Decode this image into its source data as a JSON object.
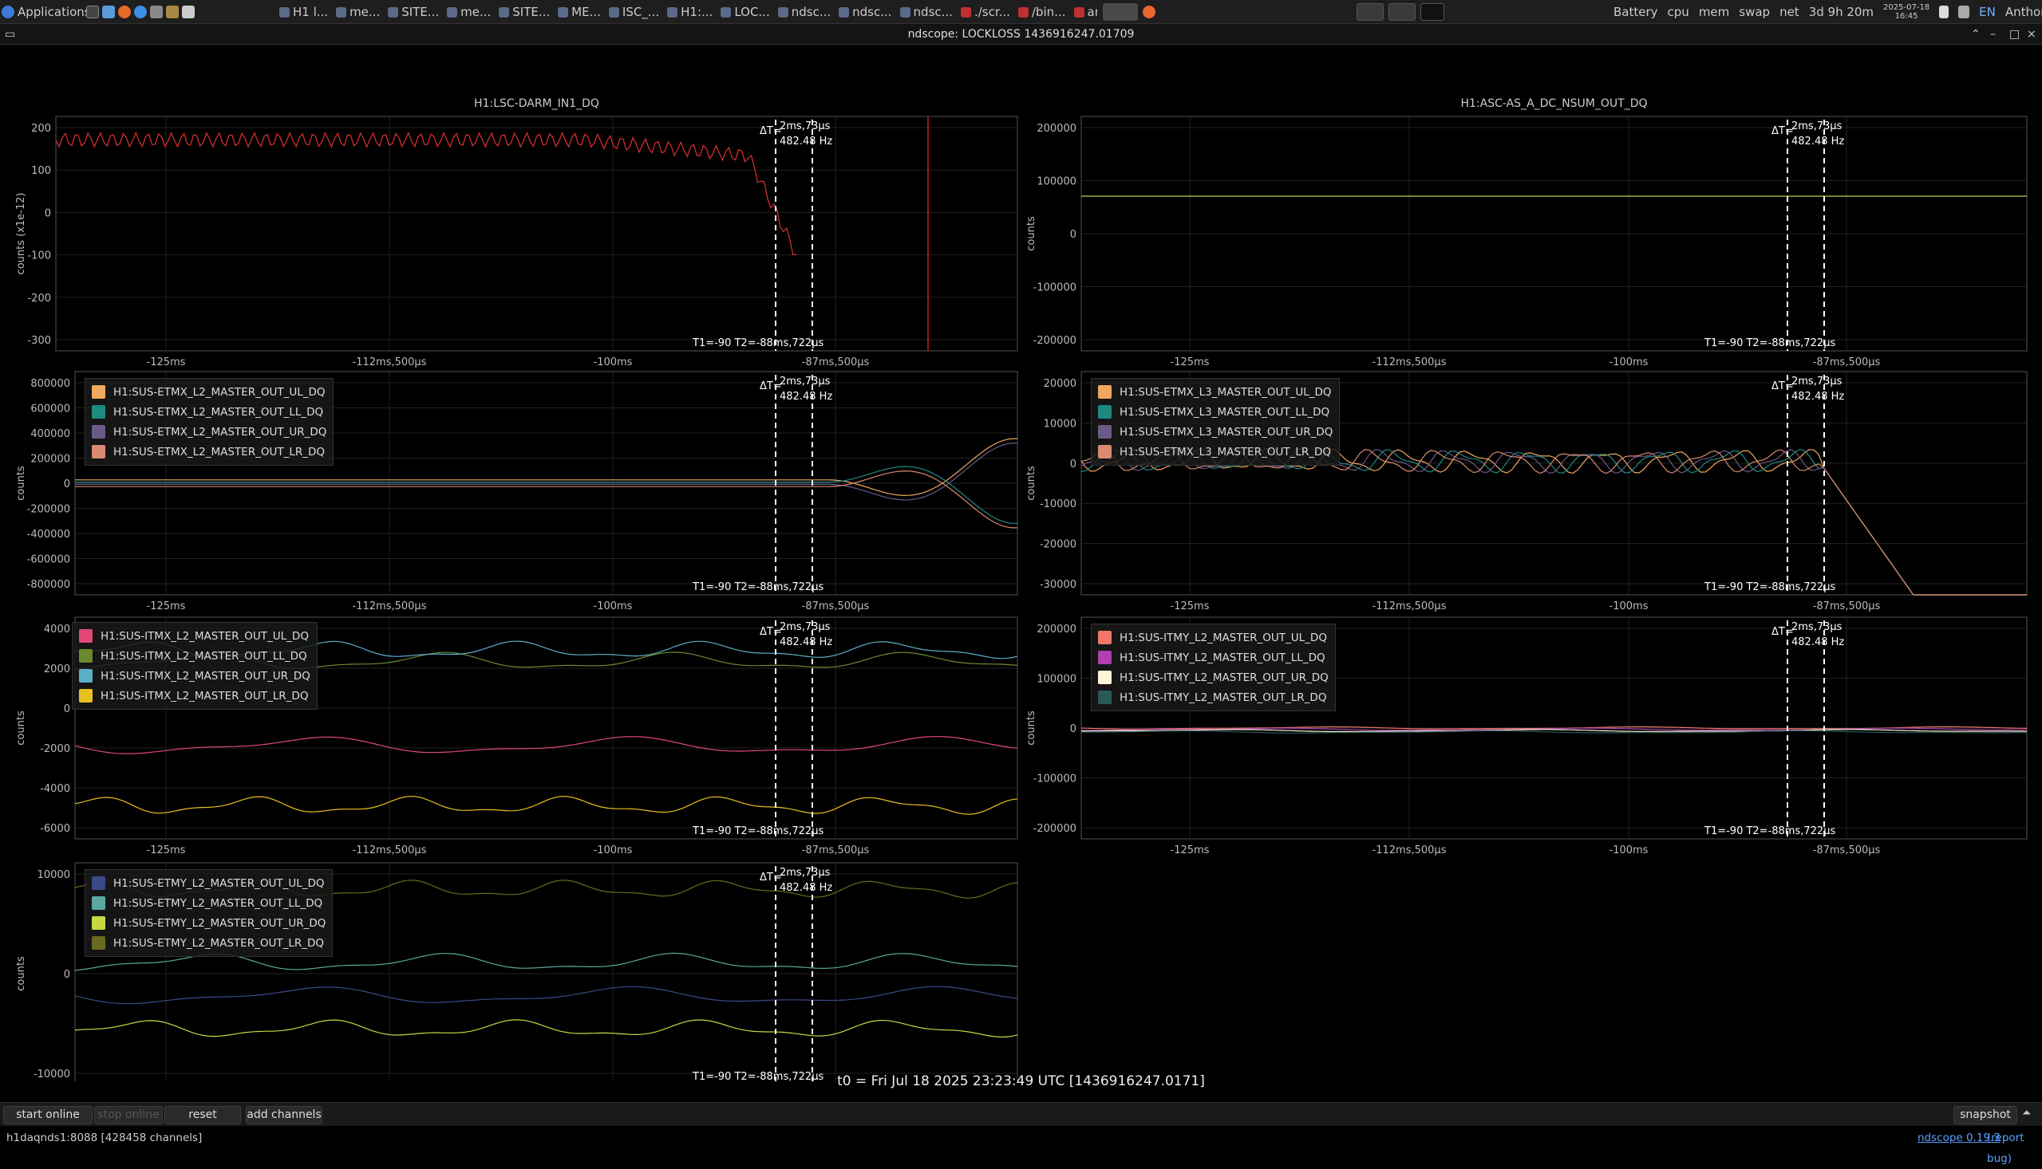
{
  "taskbar": {
    "applications_label": "Applications",
    "items": [
      "H1 l...",
      "me...",
      "SITE...",
      "me...",
      "SITE...",
      "ME...",
      "ISC_...",
      "H1:...",
      "LOC...",
      "ndsc...",
      "ndsc...",
      "ndsc...",
      "./scr...",
      "/bin...",
      "anth..."
    ],
    "tray": {
      "battery": "Battery",
      "cpu": "cpu",
      "mem": "mem",
      "swap": "swap",
      "net": "net",
      "uptime": "3d 9h 20m",
      "date": "2025-07-18",
      "time": "16:45",
      "lang": "EN",
      "user": "Anthony Sanchez"
    }
  },
  "window": {
    "title": "ndscope: LOCKLOSS 1436916247.01709"
  },
  "xticks": [
    "-125ms",
    "-112ms,500µs",
    "-100ms",
    "-87ms,500µs"
  ],
  "cursor": {
    "delta_label": "ΔT=",
    "delta_value": "2ms,73µs",
    "freq": "482.48 Hz",
    "t12": "T1=-90 T2=-88ms,722µs"
  },
  "plots": [
    {
      "id": "darm",
      "title": "H1:LSC-DARM_IN1_DQ",
      "ylabel": "counts (x1e-12)",
      "yticks": [
        "200",
        "100",
        "0",
        "-100",
        "-200",
        "-300"
      ],
      "legend": []
    },
    {
      "id": "asc",
      "title": "H1:ASC-AS_A_DC_NSUM_OUT_DQ",
      "ylabel": "counts",
      "yticks": [
        "200000",
        "100000",
        "0",
        "-100000",
        "-200000"
      ],
      "legend": []
    },
    {
      "id": "etmx_l2",
      "title": "",
      "ylabel": "counts",
      "yticks": [
        "800000",
        "600000",
        "400000",
        "200000",
        "0",
        "-200000",
        "-400000",
        "-600000",
        "-800000"
      ],
      "legend": [
        {
          "name": "H1:SUS-ETMX_L2_MASTER_OUT_UL_DQ",
          "color": "#f0a860"
        },
        {
          "name": "H1:SUS-ETMX_L2_MASTER_OUT_LL_DQ",
          "color": "#1e8a80"
        },
        {
          "name": "H1:SUS-ETMX_L2_MASTER_OUT_UR_DQ",
          "color": "#6a5a88"
        },
        {
          "name": "H1:SUS-ETMX_L2_MASTER_OUT_LR_DQ",
          "color": "#d98a70"
        }
      ]
    },
    {
      "id": "etmx_l3",
      "title": "",
      "ylabel": "counts",
      "yticks": [
        "20000",
        "10000",
        "0",
        "-10000",
        "-20000",
        "-30000"
      ],
      "legend": [
        {
          "name": "H1:SUS-ETMX_L3_MASTER_OUT_UL_DQ",
          "color": "#f0a860"
        },
        {
          "name": "H1:SUS-ETMX_L3_MASTER_OUT_LL_DQ",
          "color": "#1e8a80"
        },
        {
          "name": "H1:SUS-ETMX_L3_MASTER_OUT_UR_DQ",
          "color": "#6a5a88"
        },
        {
          "name": "H1:SUS-ETMX_L3_MASTER_OUT_LR_DQ",
          "color": "#d98a70"
        }
      ]
    },
    {
      "id": "itmx_l2",
      "title": "",
      "ylabel": "counts",
      "yticks": [
        "4000",
        "2000",
        "0",
        "-2000",
        "-4000",
        "-6000"
      ],
      "legend": [
        {
          "name": "H1:SUS-ITMX_L2_MASTER_OUT_UL_DQ",
          "color": "#e04878"
        },
        {
          "name": "H1:SUS-ITMX_L2_MASTER_OUT_LL_DQ",
          "color": "#6a8a30"
        },
        {
          "name": "H1:SUS-ITMX_L2_MASTER_OUT_UR_DQ",
          "color": "#5ab0c8"
        },
        {
          "name": "H1:SUS-ITMX_L2_MASTER_OUT_LR_DQ",
          "color": "#e8c020"
        }
      ]
    },
    {
      "id": "itmy_l2",
      "title": "",
      "ylabel": "counts",
      "yticks": [
        "200000",
        "100000",
        "0",
        "-100000",
        "-200000"
      ],
      "legend": [
        {
          "name": "H1:SUS-ITMY_L2_MASTER_OUT_UL_DQ",
          "color": "#f07868"
        },
        {
          "name": "H1:SUS-ITMY_L2_MASTER_OUT_LL_DQ",
          "color": "#b040b0"
        },
        {
          "name": "H1:SUS-ITMY_L2_MASTER_OUT_UR_DQ",
          "color": "#fff4d8"
        },
        {
          "name": "H1:SUS-ITMY_L2_MASTER_OUT_LR_DQ",
          "color": "#2a5a58"
        }
      ]
    },
    {
      "id": "etmy_l2",
      "title": "",
      "ylabel": "counts",
      "yticks": [
        "10000",
        "0",
        "-10000"
      ],
      "legend": [
        {
          "name": "H1:SUS-ETMY_L2_MASTER_OUT_UL_DQ",
          "color": "#3a4a88"
        },
        {
          "name": "H1:SUS-ETMY_L2_MASTER_OUT_LL_DQ",
          "color": "#5aa8a0"
        },
        {
          "name": "H1:SUS-ETMY_L2_MASTER_OUT_UR_DQ",
          "color": "#c8d840"
        },
        {
          "name": "H1:SUS-ETMY_L2_MASTER_OUT_LR_DQ",
          "color": "#6a6a20"
        }
      ]
    }
  ],
  "t0_label": "t0 = Fri Jul 18 2025 23:23:49 UTC [1436916247.0171]",
  "buttons": {
    "start_online": "start online",
    "stop_online": "stop online",
    "reset": "reset",
    "add_channels": "add channels",
    "snapshot": "snapshot"
  },
  "status": {
    "server": "h1daqnds1:8088  [428458 channels]",
    "version_link": "ndscope 0.19.3",
    "report_bug": "(report bug)"
  }
}
